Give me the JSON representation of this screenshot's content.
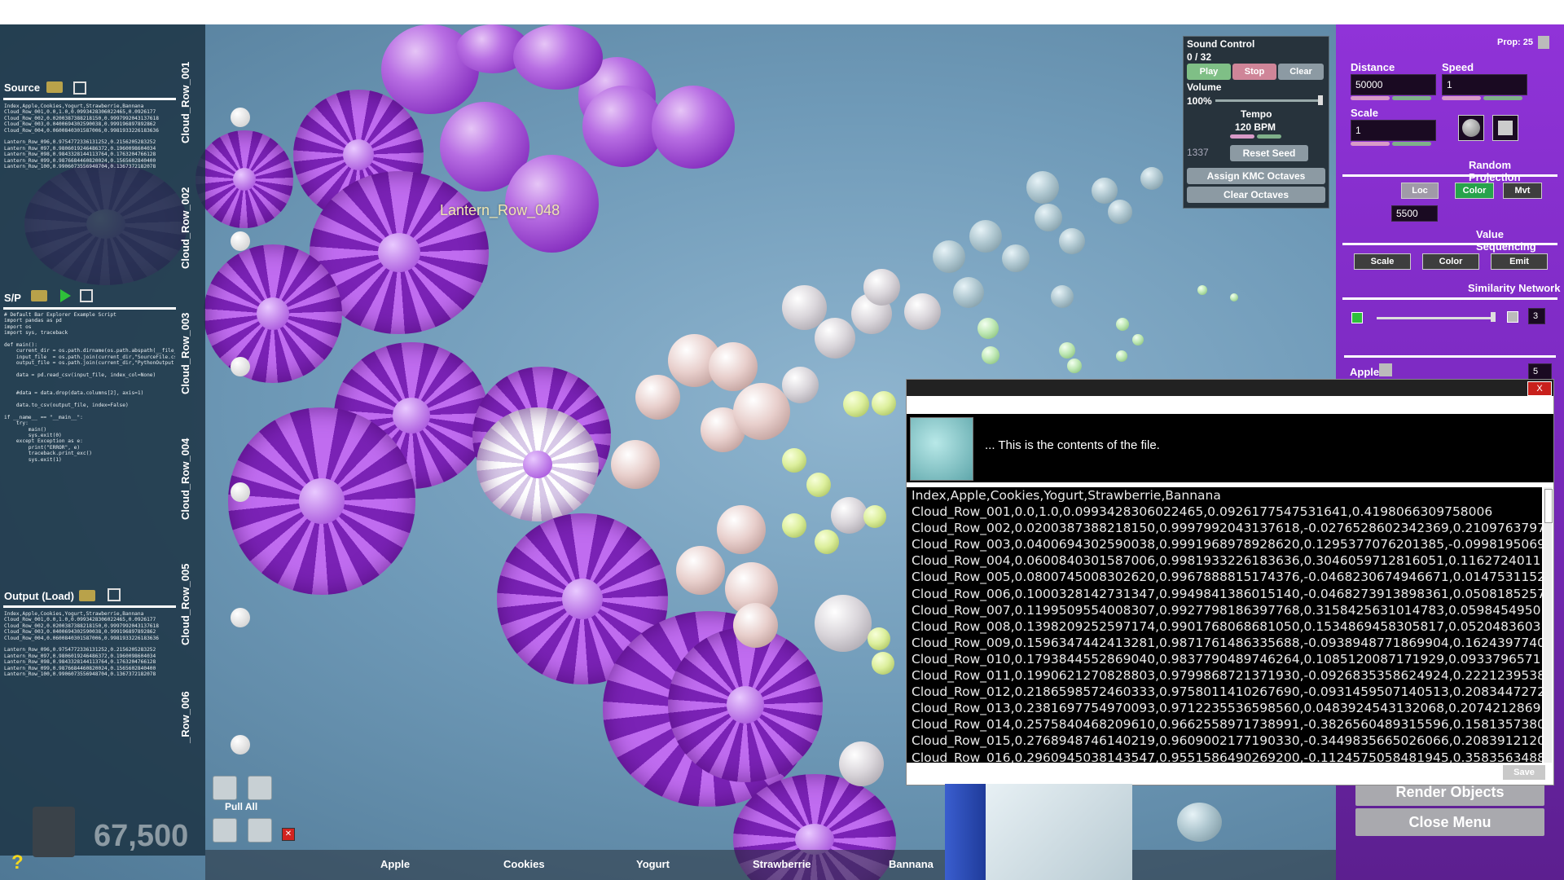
{
  "left_panel": {
    "source": {
      "title": "Source",
      "lines": [
        "Index,Apple,Cookies,Yogurt,Strawberrie,Bannana",
        "Cloud_Row_001,0.0,1.0,0.0993428306022465,0.0926177",
        "Cloud_Row_002,0.0200387388218150,0.9997992043137618",
        "Cloud_Row_003,0.0400694302590038,0.999196897892862",
        "Cloud_Row_004,0.0600840301587006,0.9981933226183636",
        "",
        "Lantern_Row_096,0.9754772336131252,0.2156205283252",
        "Lantern_Row_097,0.9806019246486372,0.1960098604034",
        "Lantern_Row_098,0.9843328144113764,0.1763204766128",
        "Lantern_Row_099,0.9876684460820024,0.1565602840400",
        "Lantern_Row_100,0.9906073556948704,0.1367372182078"
      ]
    },
    "script": {
      "title": "S/P",
      "lines": [
        "# Default Bar Explorer Example Script",
        "import pandas as pd",
        "import os",
        "import sys, traceback",
        "",
        "def main():",
        "    current_dir = os.path.dirname(os.path.abspath(__file__))",
        "    input_file  = os.path.join(current_dir,\"SourceFile.csv\")",
        "    output_file = os.path.join(current_dir,\"PythonOutput.csv\")",
        "",
        "    data = pd.read_csv(input_file, index_col=None)",
        "",
        "",
        "    #data = data.drop(data.columns[2], axis=1)",
        "",
        "    data.to_csv(output_file, index=False)",
        "",
        "if __name__ == \"__main__\":",
        "    try:",
        "        main()",
        "        sys.exit(0)",
        "    except Exception as e:",
        "        print(\"ERROR\", e)",
        "        traceback.print_exc()",
        "        sys.exit(1)"
      ]
    },
    "output": {
      "title": "Output (Load)",
      "lines": [
        "Index,Apple,Cookies,Yogurt,Strawberrie,Bannana",
        "Cloud_Row_001,0.0,1.0,0.0993428306022465,0.0926177",
        "Cloud_Row_002,0.0200387388218150,0.9997992043137618",
        "Cloud_Row_003,0.0400694302590038,0.999196897892862",
        "Cloud_Row_004,0.0600840301587006,0.9981933226183636",
        "",
        "Lantern_Row_096,0.9754772336131252,0.2156205283252",
        "Lantern_Row_097,0.9806019246486372,0.1960098604034",
        "Lantern_Row_098,0.9843328144113764,0.1763204766128",
        "Lantern_Row_099,0.9876684460820024,0.1565602840400",
        "Lantern_Row_100,0.9906073556948704,0.1367372182078"
      ]
    },
    "row_labels": [
      "Cloud_Row_001",
      "Cloud_Row_002",
      "Cloud_Row_003",
      "Cloud_Row_004",
      "Cloud_Row_005",
      "_Row_006"
    ],
    "pull_all": "Pull All",
    "counter": "67,500",
    "help": "?",
    "x_glyph": "✕"
  },
  "scene": {
    "hover_label": "Lantern_Row_048"
  },
  "bottom_bar": {
    "categories": [
      "Apple",
      "Cookies",
      "Yogurt",
      "Strawberrie",
      "Bannana"
    ]
  },
  "sound_control": {
    "title": "Sound Control",
    "progress": "0 / 32",
    "play": "Play",
    "stop": "Stop",
    "clear": "Clear",
    "volume_label": "Volume",
    "volume_value": "100%",
    "tempo_label": "Tempo",
    "tempo_value": "120 BPM",
    "seed": "1337",
    "reset_seed": "Reset Seed",
    "assign_kmc": "Assign KMC Octaves",
    "clear_octaves": "Clear Octaves"
  },
  "right_panel": {
    "prop": "Prop: 25",
    "distance_label": "Distance",
    "distance_value": "50000",
    "speed_label": "Speed",
    "speed_value": "1",
    "scale_label": "Scale",
    "scale_value": "1",
    "random_projection": "Random Projection",
    "rp_buttons": [
      "Loc",
      "Color",
      "Mvt"
    ],
    "rp_value": "5500",
    "value_sequencing": "Value Sequencing",
    "vs_buttons": [
      "Scale",
      "Color",
      "Emit"
    ],
    "similarity_network": "Similarity Network",
    "sim_value": "3",
    "apple_label": "Apple",
    "apple_value": "5",
    "render_objects": "Render Objects",
    "close_menu": "Close Menu"
  },
  "file_viewer": {
    "message": "... This is the contents of the file.",
    "close": "X",
    "save": "Save",
    "lines": [
      "Index,Apple,Cookies,Yogurt,Strawberrie,Bannana",
      "Cloud_Row_001,0.0,1.0,0.0993428306022465,0.0926177547531641,0.4198066309758006",
      "Cloud_Row_002,0.0200387388218150,0.9997992043137618,-0.0276528602342369,0.2109763797",
      "Cloud_Row_003,0.0400694302590038,0.9991968978928620,0.1295377076201385,-0.0998195069",
      "Cloud_Row_004,0.0600840301587006,0.9981933226183636,0.3046059712816051,0.1162724011",
      "Cloud_Row_005,0.0800745008302620,0.9967888815174376,-0.0468230674946671,0.0147531152",
      "Cloud_Row_006,0.1000328142731347,0.9949841386015140,-0.0468273913898361,0.0508185257",
      "Cloud_Row_007,0.1199509554008307,0.9927798186397768,0.3158425631014783,0.0598454950",
      "Cloud_Row_008,0.1398209252597174,0.9901768068681050,0.1534869458305817,0.0520483603",
      "Cloud_Row_009,0.1596347442413281,0.9871761486335688,-0.0938948771869904,0.1624397740",
      "Cloud_Row_010,0.1793844552869040,0.9837790489746264,0.1085120087171929,0.0933796571",
      "Cloud_Row_011,0.1990621270828803,0.9799868721371930,-0.0926835358624924,0.2221239538",
      "Cloud_Row_012,0.2186598572460333,0.9758011410267690,-0.0931459507140513,0.2083447272",
      "Cloud_Row_013,0.2381697754970093,0.9712235536598560,0.0483924543132068,0.2074212869",
      "Cloud_Row_014,0.2575840468209610,0.9662558971738991,-0.3826560489315596,0.1581357380",
      "Cloud_Row_015,0.2768948746140219,0.9609002177190330,-0.3449835665026066,0.2083912120",
      "Cloud_Row_016,0.2960945038143547,0.9551586490269200,-0.1124575058481945,0.3583563488"
    ]
  }
}
